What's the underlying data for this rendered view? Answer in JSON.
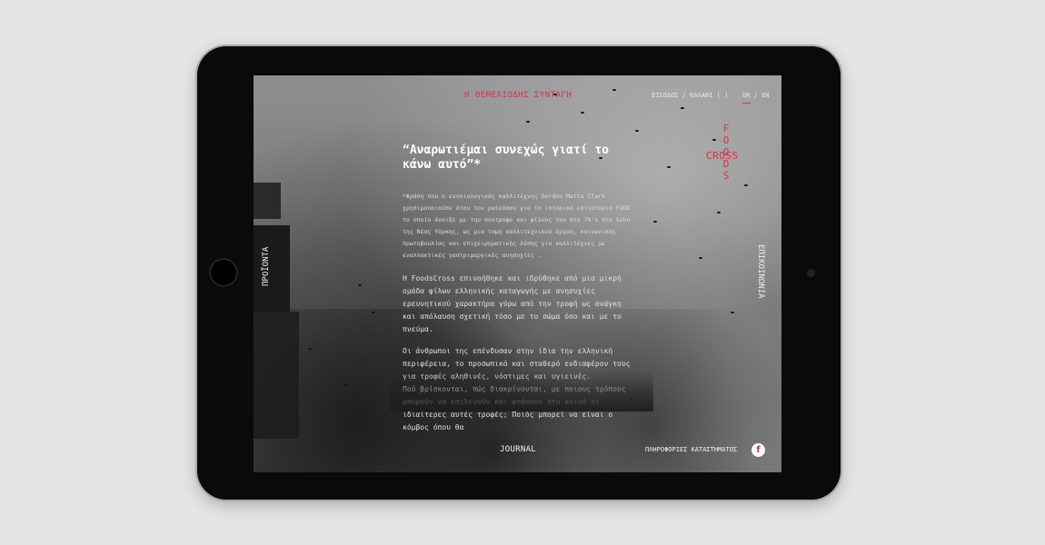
{
  "topnav": {
    "recipe_link": "Η ΘΕΜΕΛΙΩΔΗΣ ΣΥΝΤΑΓΗ",
    "account_link": "ΕΙΣΟΔΟΣ / ΚΑΛΑΘΙ ( )",
    "lang": "GR / EN"
  },
  "logo": {
    "vertical": "F\nO\nO\nD\nS",
    "horizontal": "CROSS"
  },
  "side": {
    "left": "ΠΡΟΪΟΝΤΑ",
    "right": "ΕΠΙΚΟΙΝΩΝΙΑ"
  },
  "content": {
    "headline": "“Αναρωτιέμαι συνεχώς γιατί το κάνω αυτό”*",
    "footnote": "*Φράση που ο εννοιολογικός καλλιτέχνης Gordon Matta Clark χρησιμοποιούσε όταν τον ρωτούσαν για το ιστορικό εστιατόριο FOOD το οποίο άνοιξε με την σύντροφο και φίλους του στα 70's στο Soho της Νέας Υόρκης, ως μια τομή καλλιτεχνικού έργου, κοινωνικής πρωτοβουλίας και επιχειρηματικής λύσης για καλλιτέχνες με εναλλακτικές γαστριμαργικές ανησυχίες .",
    "para1": "Η FoodsCross επινοήθηκε και ιδρύθηκε από μια μικρή ομάδα φίλων ελληνικής καταγωγής με ανησυχίες ερευνητικού χαρακτήρα γύρω από την τροφή ως ανάγκη και απόλαυση σχετική τόσο με το σώμα όσο και με το πνεύμα.",
    "para2": "Οι άνθρωποι της επένδυσαν στην ίδια την ελληνική περιφέρεια, το προσωπικό και σταθερό ενδιαφέρον τους για τροφές αληθινές, νόστιμες και υγιεινές.",
    "para3": "Πού βρίσκονται, πώς διακρίνονται, με ποιους τρόπους μπορούν να επιλεγούν και φτάσουν στο κοινό οι ιδιαίτερες αυτές τροφές; Ποιός μπορεί να είναι ο κόμβος όπου θα"
  },
  "footer": {
    "journal": "JOURNAL",
    "store_info": "ΠΛΗΡΟΦΟΡΙΕΣ ΚΑΤΑΣΤΗΜΑΤΟΣ",
    "facebook_icon": "f"
  },
  "colors": {
    "accent": "#d2334a",
    "bezel": "#0a0a0a",
    "background": "#e5e5e5"
  }
}
